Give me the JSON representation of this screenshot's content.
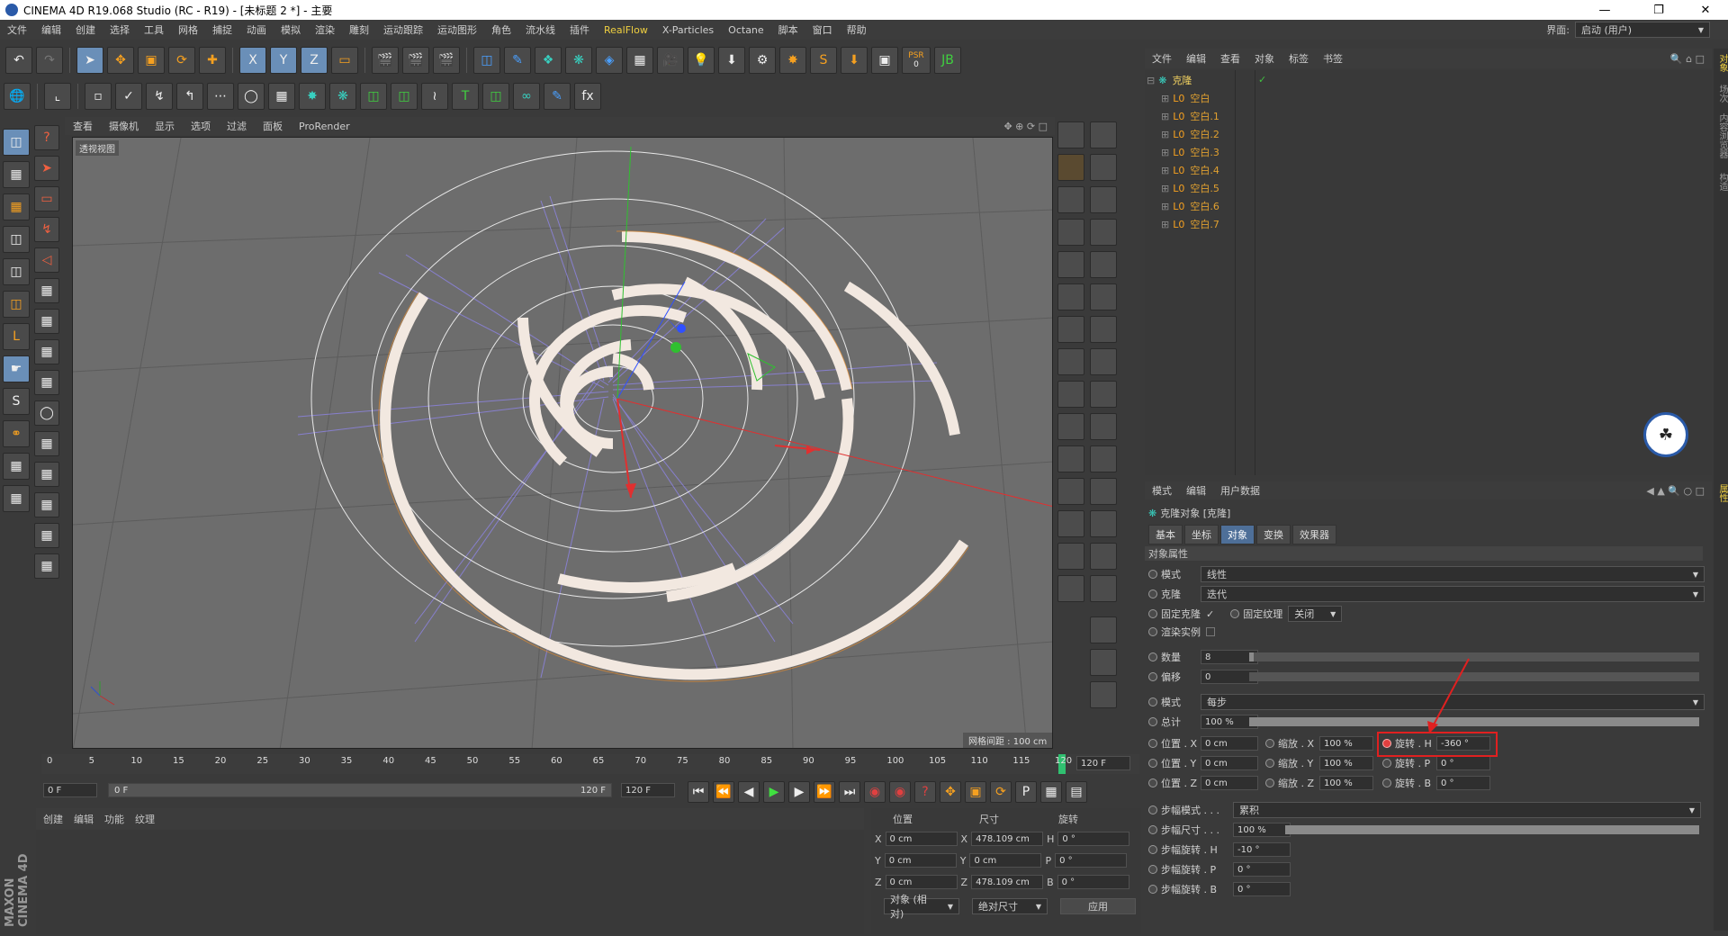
{
  "window": {
    "title": "CINEMA 4D R19.068 Studio (RC - R19) - [未标题 2 *] - 主要",
    "controls": [
      "minimize",
      "restore",
      "close"
    ]
  },
  "menu": {
    "items": [
      "文件",
      "编辑",
      "创建",
      "选择",
      "工具",
      "网格",
      "捕捉",
      "动画",
      "模拟",
      "渲染",
      "雕刻",
      "运动跟踪",
      "运动图形",
      "角色",
      "流水线",
      "插件",
      "RealFlow",
      "X-Particles",
      "Octane",
      "脚本",
      "窗口",
      "帮助"
    ],
    "layout_label": "界面:",
    "layout_value": "启动 (用户)"
  },
  "toolbar": {
    "axis_labels": [
      "X",
      "Y",
      "Z"
    ],
    "psr_label": "PSR",
    "psr_value": "0"
  },
  "viewport": {
    "menu": [
      "查看",
      "摄像机",
      "显示",
      "选项",
      "过滤",
      "面板",
      "ProRender"
    ],
    "view_name": "透视视图",
    "grid_note": "网格间距 : 100 cm"
  },
  "timeline": {
    "ticks": [
      "0",
      "5",
      "10",
      "15",
      "20",
      "25",
      "30",
      "35",
      "40",
      "45",
      "50",
      "55",
      "60",
      "65",
      "70",
      "75",
      "80",
      "85",
      "90",
      "95",
      "100",
      "105",
      "110",
      "115",
      "120"
    ],
    "end_frame": "120 F",
    "current_frame": "0 F",
    "range_start": "0 F",
    "range_end": "120 F",
    "range_end2": "120 F"
  },
  "object_manager": {
    "menu": [
      "文件",
      "编辑",
      "查看",
      "对象",
      "标签",
      "书签"
    ],
    "root": "克隆",
    "children": [
      "空白",
      "空白.1",
      "空白.2",
      "空白.3",
      "空白.4",
      "空白.5",
      "空白.6",
      "空白.7"
    ]
  },
  "attributes": {
    "menu": [
      "模式",
      "编辑",
      "用户数据"
    ],
    "title": "克隆对象 [克隆]",
    "tabs": [
      "基本",
      "坐标",
      "对象",
      "变换",
      "效果器"
    ],
    "active_tab": "对象",
    "section": "对象属性",
    "mode_label": "模式",
    "mode_value": "线性",
    "clone_label": "克隆",
    "clone_value": "迭代",
    "fix_clone_label": "固定克隆",
    "fix_clone_check": "✓",
    "fix_texture_label": "固定纹理",
    "fix_texture_value": "关闭",
    "render_instance_label": "渲染实例",
    "count_label": "数量",
    "count_value": "8",
    "count_fraction": 0.01,
    "offset_label": "偏移",
    "offset_value": "0",
    "mode2_label": "模式",
    "mode2_value": "每步",
    "total_label": "总计",
    "total_value": "100 %",
    "total_fraction": 1.0,
    "pos_x_label": "位置 . X",
    "pos_x_value": "0 cm",
    "scale_x_label": "缩放 . X",
    "scale_x_value": "100 %",
    "rot_h_label": "旋转 . H",
    "rot_h_value": "-360 °",
    "pos_y_label": "位置 . Y",
    "pos_y_value": "0 cm",
    "scale_y_label": "缩放 . Y",
    "scale_y_value": "100 %",
    "rot_p_label": "旋转 . P",
    "rot_p_value": "0 °",
    "pos_z_label": "位置 . Z",
    "pos_z_value": "0 cm",
    "scale_z_label": "缩放 . Z",
    "scale_z_value": "100 %",
    "rot_b_label": "旋转 . B",
    "rot_b_value": "0 °",
    "step_mode_label": "步幅模式 . . .",
    "step_mode_value": "累积",
    "step_size_label": "步幅尺寸 . . .",
    "step_size_value": "100 %",
    "step_size_fraction": 1.0,
    "step_rot_h_label": "步幅旋转 . H",
    "step_rot_h_value": "-10 °",
    "step_rot_p_label": "步幅旋转 . P",
    "step_rot_p_value": "0 °",
    "step_rot_b_label": "步幅旋转 . B",
    "step_rot_b_value": "0 °"
  },
  "material_manager": {
    "menu": [
      "创建",
      "编辑",
      "功能",
      "纹理"
    ],
    "brand": "MAXON CINEMA 4D"
  },
  "coordinates": {
    "headers": [
      "位置",
      "尺寸",
      "旋转"
    ],
    "rows": [
      {
        "axis": "X",
        "pos": "0 cm",
        "size_axis": "X",
        "size": "478.109 cm",
        "rot_axis": "H",
        "rot": "0 °"
      },
      {
        "axis": "Y",
        "pos": "0 cm",
        "size_axis": "Y",
        "size": "0 cm",
        "rot_axis": "P",
        "rot": "0 °"
      },
      {
        "axis": "Z",
        "pos": "0 cm",
        "size_axis": "Z",
        "size": "478.109 cm",
        "rot_axis": "B",
        "rot": "0 °"
      }
    ],
    "mode1": "对象 (相对)",
    "mode2": "绝对尺寸",
    "apply": "应用"
  },
  "right_strip": [
    "对象",
    "场次",
    "内容浏览器",
    "构造"
  ],
  "right_strip2": [
    "属性"
  ],
  "colors": {
    "accent": "#4e6f98",
    "highlight_box": "#e02020",
    "object_name": "#e0a030",
    "ring_fill": "#f2e8e0",
    "ring_edge": "#e08a30"
  }
}
